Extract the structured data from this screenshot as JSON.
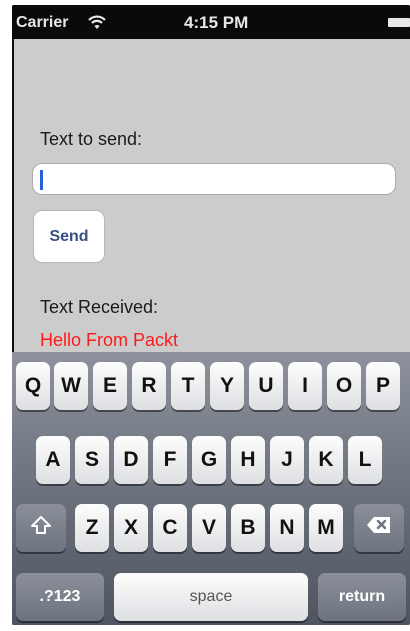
{
  "status_bar": {
    "carrier": "Carrier",
    "time": "4:15 PM"
  },
  "screen": {
    "send_label": "Text to send:",
    "text_field_value": "",
    "send_button": "Send",
    "received_label": "Text Received:",
    "received_value": "Hello From Packt"
  },
  "keyboard": {
    "row1": [
      "Q",
      "W",
      "E",
      "R",
      "T",
      "Y",
      "U",
      "I",
      "O",
      "P"
    ],
    "row2": [
      "A",
      "S",
      "D",
      "F",
      "G",
      "H",
      "J",
      "K",
      "L"
    ],
    "row3": [
      "Z",
      "X",
      "C",
      "V",
      "B",
      "N",
      "M"
    ],
    "numbers_key": ".?123",
    "space_key": "space",
    "return_key": "return"
  },
  "colors": {
    "received_text": "#ff1a1a",
    "button_text": "#384f84",
    "app_background": "#cccccc"
  }
}
